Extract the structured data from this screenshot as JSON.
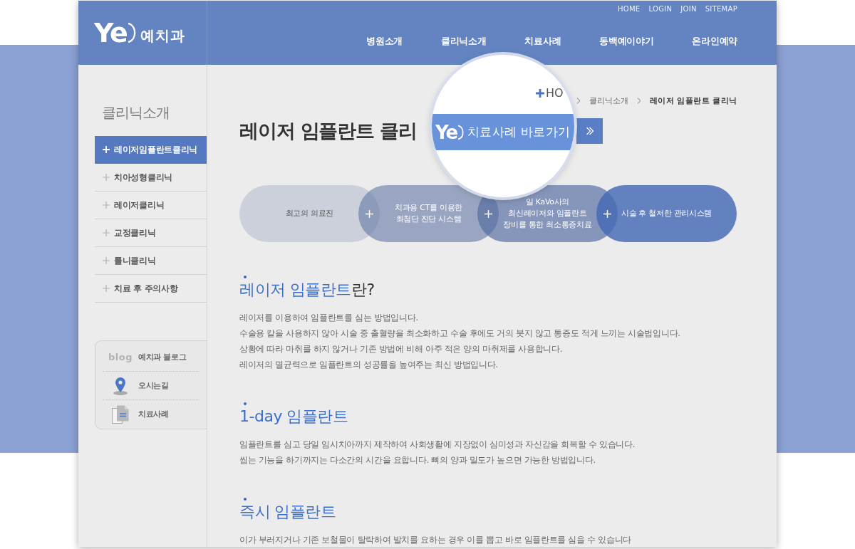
{
  "header": {
    "logo": {
      "mark": "Ye",
      "name": "예치과"
    },
    "utility_links": [
      "HOME",
      "LOGIN",
      "JOIN",
      "SITEMAP"
    ],
    "nav": [
      "병원소개",
      "클리닉소개",
      "치료사례",
      "동백예이야기",
      "온라인예약"
    ]
  },
  "sidebar": {
    "title": "클리닉소개",
    "items": [
      {
        "label": "레이저임플란트클리닉",
        "selected": true
      },
      {
        "label": "치아성형클리닉",
        "selected": false
      },
      {
        "label": "레이저클리닉",
        "selected": false
      },
      {
        "label": "교정클리닉",
        "selected": false
      },
      {
        "label": "틀니클리닉",
        "selected": false
      },
      {
        "label": "치료 후 주의사항",
        "selected": false
      }
    ],
    "quick_links": [
      {
        "kind": "blog",
        "badge": "blog",
        "label": "예치과 블로그"
      },
      {
        "kind": "location",
        "label": "오시는길"
      },
      {
        "kind": "document",
        "label": "치료사례"
      }
    ]
  },
  "breadcrumb": [
    "클리닉소개",
    "레이저 임플란트 클리닉"
  ],
  "page_title": "레이저 임플란트 클리",
  "magnifier": {
    "breadcrumb_start": "HO",
    "button": {
      "logo": "Ye",
      "label": "치료사례 바로가기"
    }
  },
  "features": [
    {
      "lines": [
        "최고의 의료진"
      ]
    },
    {
      "lines": [
        "치과용 CT를 이용한",
        "최첨단 진단 시스템"
      ]
    },
    {
      "lines": [
        "일 KaVo사의",
        "최신레이저와 임플란트",
        "장비를 통한 최소통증치료"
      ]
    },
    {
      "lines": [
        "시술 후 철저한 관리시스템"
      ]
    }
  ],
  "sections": [
    {
      "heading": "레이저 임플란트",
      "heading_suffix": "란?",
      "lines": [
        "레이저를 이용하여 임플란트를 심는 방법입니다.",
        "수술용 칼을 사용하지 않아 시술 중 출혈량을 최소화하고 수술 후에도 거의 붓지 않고 통증도 적게 느끼는 시술법입니다.",
        "상황에 따라 마취를 하지 않거나 기존 방법에 비해 아주 적은 양의 마취제를 사용합니다.",
        "레이저의 멸균력으로 임플란트의 성공률을 높여주는 최신 방법입니다."
      ]
    },
    {
      "heading": "1-day 임플란트",
      "lines": [
        "임플란트를 심고 당일 임시치아까지 제작하여 사회생활에 지장없이 심미성과 자신감을 회복할 수 있습니다.",
        "씹는 기능을 하기까지는 다소간의 시간을 요합니다. 뼈의 양과 밀도가 높으면 가능한 방법입니다."
      ]
    },
    {
      "heading": "즉시 임플란트",
      "lines": [
        "이가 부러지거나 기존 보철물이 탈락하여 발치를 요하는 경우 이를 뽑고 바로 임플란트를 심을 수 있습니다"
      ]
    }
  ]
}
